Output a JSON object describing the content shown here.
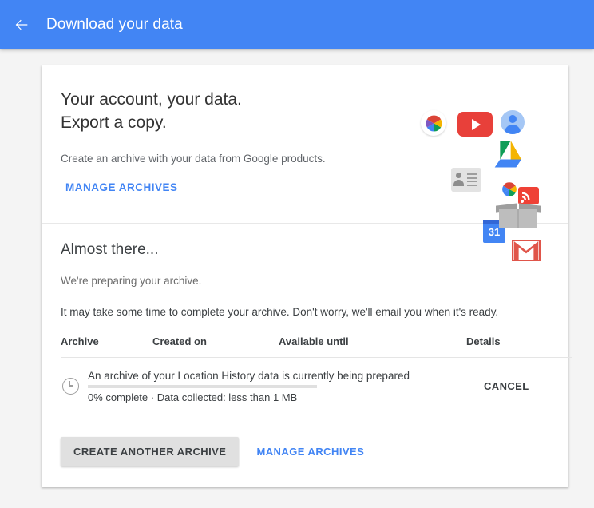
{
  "appbar": {
    "back_icon": "arrow-left-icon",
    "title": "Download your data",
    "background": "#4285f4"
  },
  "hero": {
    "title_line1": "Your account, your data.",
    "title_line2": "Export a copy.",
    "subtitle": "Create an archive with your data from Google products.",
    "manage_link": "MANAGE ARCHIVES",
    "illustration_icons": [
      "google-photos-icon",
      "youtube-icon",
      "account-avatar-icon",
      "google-contacts-icon",
      "google-drive-icon",
      "google-calendar-icon",
      "gmail-icon",
      "blogger-icon",
      "shipping-box-icon"
    ],
    "calendar_day": "31"
  },
  "progress_section": {
    "title": "Almost there...",
    "subtitle": "We're preparing your archive.",
    "note": "It may take some time to complete your archive. Don't worry, we'll email you when it's ready."
  },
  "table": {
    "headers": {
      "archive": "Archive",
      "created_on": "Created on",
      "available_until": "Available until",
      "details": "Details"
    },
    "rows": [
      {
        "status_icon": "clock-icon",
        "name": "An archive of your Location History data is currently being prepared",
        "progress_percent": 0,
        "status": "0% complete · Data collected: less than 1 MB",
        "action": "CANCEL"
      }
    ]
  },
  "footer": {
    "create_button": "CREATE ANOTHER ARCHIVE",
    "manage_link": "MANAGE ARCHIVES"
  },
  "colors": {
    "accent": "#4285f4",
    "page_background": "#f4f4f4",
    "card_background": "#ffffff",
    "text_primary": "#3c4043",
    "text_secondary": "#6d6d6d"
  }
}
